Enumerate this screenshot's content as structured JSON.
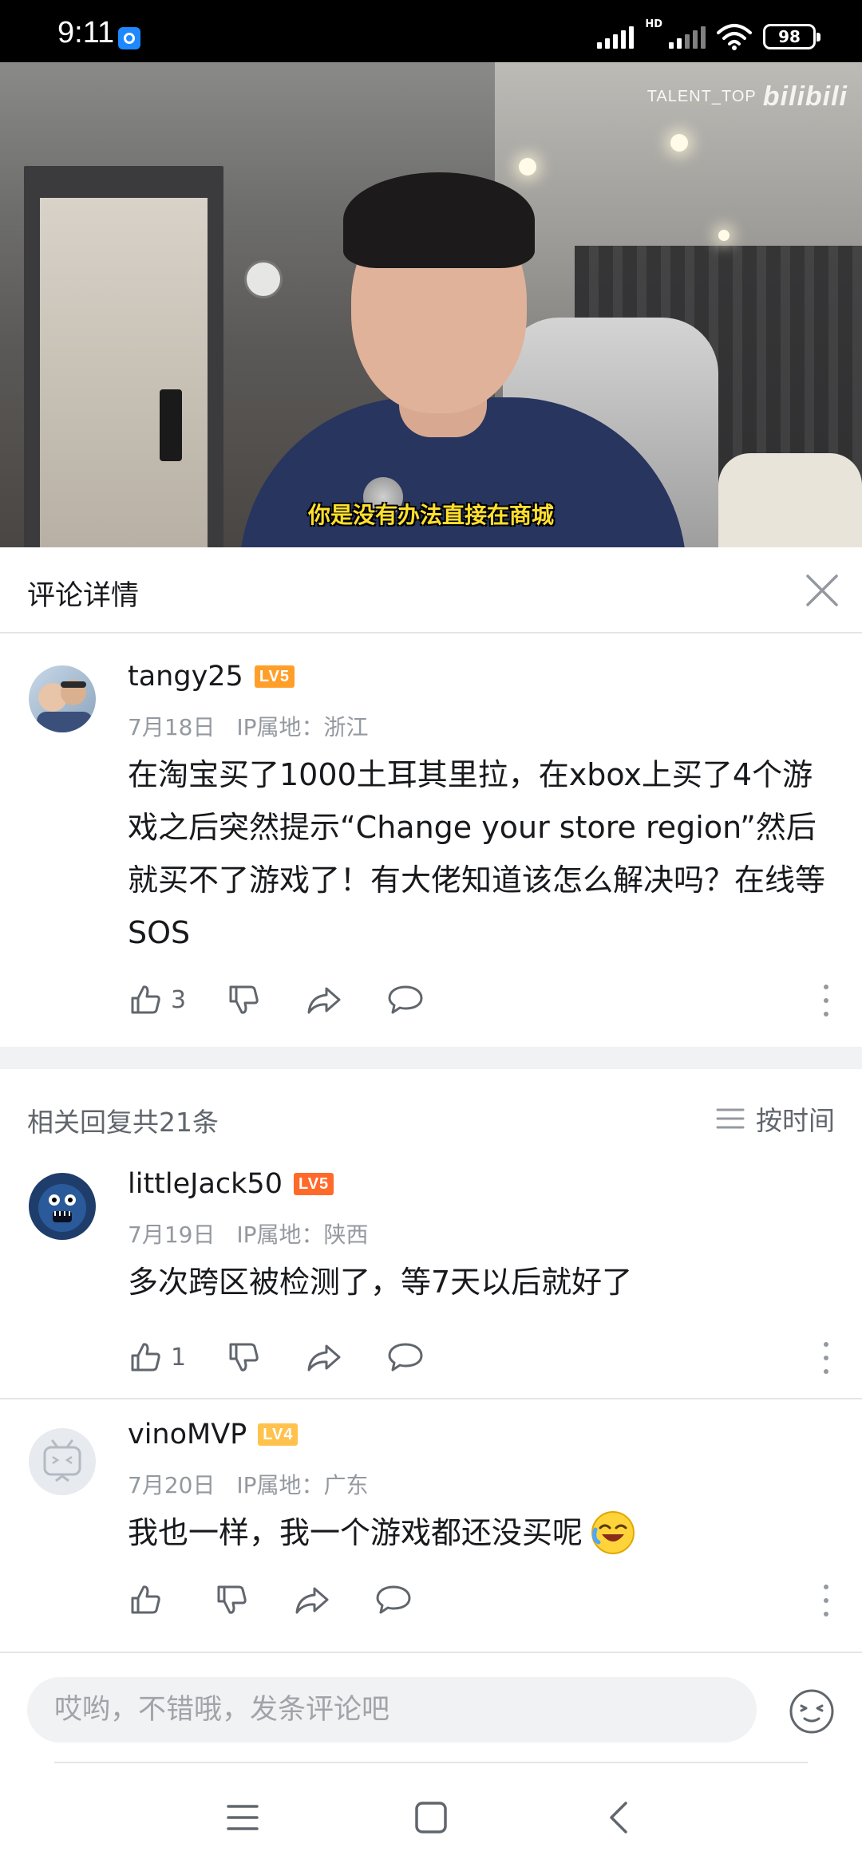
{
  "status_bar": {
    "time": "9:11",
    "network_label": "HD",
    "battery": "98"
  },
  "video": {
    "watermark_text": "TALENT_TOP",
    "watermark_logo": "bilibili",
    "subtitle": "你是没有办法直接在商城"
  },
  "panel": {
    "title": "评论详情"
  },
  "main_comment": {
    "username": "tangy25",
    "level": "LV5",
    "date": "7月18日",
    "ip_location": "IP属地：浙江",
    "text": "在淘宝买了1000土耳其里拉，在xbox上买了4个游戏之后突然提示“Change your store region”然后就买不了游戏了！有大佬知道该怎么解决吗？在线等SOS",
    "likes": "3"
  },
  "replies_header": {
    "count_label": "相关回复共21条",
    "sort_label": "按时间"
  },
  "replies": [
    {
      "username": "littleJack50",
      "level": "LV5",
      "date": "7月19日",
      "ip_location": "IP属地：陕西",
      "text": "多次跨区被检测了，等7天以后就好了",
      "likes": "1"
    },
    {
      "username": "vinoMVP",
      "level": "LV4",
      "date": "7月20日",
      "ip_location": "IP属地：广东",
      "text": "我也一样，我一个游戏都还没买呢",
      "likes": ""
    }
  ],
  "input": {
    "placeholder": "哎哟，不错哦，发条评论吧"
  },
  "colors": {
    "accent_pink": "#fb7299",
    "text_primary": "#18191c",
    "text_secondary": "#9499a0",
    "level5": "#ff9f2a",
    "level4": "#ffc24d"
  }
}
